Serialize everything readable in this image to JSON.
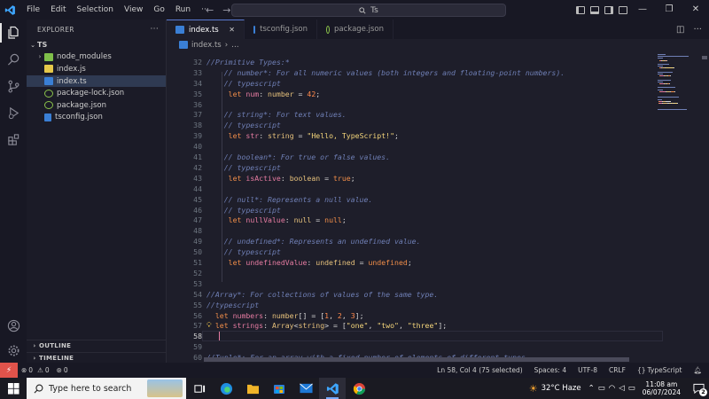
{
  "menu": [
    "File",
    "Edit",
    "Selection",
    "View",
    "Go",
    "Run",
    "···"
  ],
  "command_center": {
    "text": "Ts"
  },
  "window_controls": {
    "minimize": "—",
    "restore": "❐",
    "close": "✕"
  },
  "explorer": {
    "title": "EXPLORER",
    "more": "···",
    "root": "TS",
    "items": [
      {
        "label": "node_modules",
        "kind": "folder"
      },
      {
        "label": "index.js",
        "kind": "js"
      },
      {
        "label": "index.ts",
        "kind": "ts"
      },
      {
        "label": "package-lock.json",
        "kind": "json"
      },
      {
        "label": "package.json",
        "kind": "json"
      },
      {
        "label": "tsconfig.json",
        "kind": "tsconfig"
      }
    ],
    "outline": "OUTLINE",
    "timeline": "TIMELINE"
  },
  "tabs": [
    {
      "label": "index.ts",
      "close": "✕"
    },
    {
      "label": "tsconfig.json"
    },
    {
      "label": "package.json"
    }
  ],
  "breadcrumb": {
    "file": "index.ts",
    "more": "…"
  },
  "code_lines": [
    {
      "n": "32",
      "t": [
        [
          "//Primitive Types:*",
          "cm"
        ]
      ]
    },
    {
      "n": "33",
      "t": [
        [
          "    // number*: For all numeric values (both integers and floating-point numbers).",
          "cm"
        ]
      ]
    },
    {
      "n": "34",
      "t": [
        [
          "    // typescript",
          "cm"
        ]
      ]
    },
    {
      "n": "35",
      "t": [
        [
          "     ",
          "op"
        ],
        [
          "let",
          "kw"
        ],
        [
          " ",
          "op"
        ],
        [
          "num",
          "var"
        ],
        [
          ": ",
          "op"
        ],
        [
          "number",
          "ty"
        ],
        [
          " = ",
          "op"
        ],
        [
          "42",
          "num"
        ],
        [
          ";",
          "op"
        ]
      ]
    },
    {
      "n": "36",
      "t": []
    },
    {
      "n": "37",
      "t": [
        [
          "    // string*: For text values.",
          "cm"
        ]
      ]
    },
    {
      "n": "38",
      "t": [
        [
          "    // typescript",
          "cm"
        ]
      ]
    },
    {
      "n": "39",
      "t": [
        [
          "     ",
          "op"
        ],
        [
          "let",
          "kw"
        ],
        [
          " ",
          "op"
        ],
        [
          "str",
          "var"
        ],
        [
          ": ",
          "op"
        ],
        [
          "string",
          "ty"
        ],
        [
          " = ",
          "op"
        ],
        [
          "\"Hello, TypeScript!\"",
          "str"
        ],
        [
          ";",
          "op"
        ]
      ]
    },
    {
      "n": "40",
      "t": []
    },
    {
      "n": "41",
      "t": [
        [
          "    // boolean*: For true or false values.",
          "cm"
        ]
      ]
    },
    {
      "n": "42",
      "t": [
        [
          "    // typescript",
          "cm"
        ]
      ]
    },
    {
      "n": "43",
      "t": [
        [
          "     ",
          "op"
        ],
        [
          "let",
          "kw"
        ],
        [
          " ",
          "op"
        ],
        [
          "isActive",
          "var"
        ],
        [
          ": ",
          "op"
        ],
        [
          "boolean",
          "ty"
        ],
        [
          " = ",
          "op"
        ],
        [
          "true",
          "kw"
        ],
        [
          ";",
          "op"
        ]
      ]
    },
    {
      "n": "44",
      "t": []
    },
    {
      "n": "45",
      "t": [
        [
          "    // null*: Represents a null value.",
          "cm"
        ]
      ]
    },
    {
      "n": "46",
      "t": [
        [
          "    // typescript",
          "cm"
        ]
      ]
    },
    {
      "n": "47",
      "t": [
        [
          "     ",
          "op"
        ],
        [
          "let",
          "kw"
        ],
        [
          " ",
          "op"
        ],
        [
          "nullValue",
          "var"
        ],
        [
          ": ",
          "op"
        ],
        [
          "null",
          "ty"
        ],
        [
          " = ",
          "op"
        ],
        [
          "null",
          "kw"
        ],
        [
          ";",
          "op"
        ]
      ]
    },
    {
      "n": "48",
      "t": []
    },
    {
      "n": "49",
      "t": [
        [
          "    // undefined*: Represents an undefined value.",
          "cm"
        ]
      ]
    },
    {
      "n": "50",
      "t": [
        [
          "    // typescript",
          "cm"
        ]
      ]
    },
    {
      "n": "51",
      "t": [
        [
          "     ",
          "op"
        ],
        [
          "let",
          "kw"
        ],
        [
          " ",
          "op"
        ],
        [
          "undefinedValue",
          "var"
        ],
        [
          ": ",
          "op"
        ],
        [
          "undefined",
          "ty"
        ],
        [
          " = ",
          "op"
        ],
        [
          "undefined",
          "kw"
        ],
        [
          ";",
          "op"
        ]
      ]
    },
    {
      "n": "52",
      "t": []
    },
    {
      "n": "53",
      "t": []
    },
    {
      "n": "54",
      "t": [
        [
          "//Array*: For collections of values of the same type.",
          "cm"
        ]
      ]
    },
    {
      "n": "55",
      "t": [
        [
          "//typescript",
          "cm"
        ]
      ]
    },
    {
      "n": "56",
      "t": [
        [
          "  ",
          "op"
        ],
        [
          "let",
          "kw"
        ],
        [
          " ",
          "op"
        ],
        [
          "numbers",
          "var"
        ],
        [
          ": ",
          "op"
        ],
        [
          "number",
          "ty"
        ],
        [
          "[] = [",
          "op"
        ],
        [
          "1",
          "num"
        ],
        [
          ", ",
          "op"
        ],
        [
          "2",
          "num"
        ],
        [
          ", ",
          "op"
        ],
        [
          "3",
          "num"
        ],
        [
          "];",
          "op"
        ]
      ]
    },
    {
      "n": "57",
      "t": [
        [
          "  ",
          "op"
        ],
        [
          "let",
          "kw"
        ],
        [
          " ",
          "op"
        ],
        [
          "strings",
          "var"
        ],
        [
          ": ",
          "op"
        ],
        [
          "Array",
          "ty"
        ],
        [
          "<",
          "op"
        ],
        [
          "string",
          "ty"
        ],
        [
          "> = [",
          "op"
        ],
        [
          "\"one\"",
          "str"
        ],
        [
          ", ",
          "op"
        ],
        [
          "\"two\"",
          "str"
        ],
        [
          ", ",
          "op"
        ],
        [
          "\"three\"",
          "str"
        ],
        [
          "];",
          "op"
        ]
      ]
    },
    {
      "n": "58",
      "t": []
    },
    {
      "n": "59",
      "t": []
    },
    {
      "n": "60",
      "t": [
        [
          "//Tuple*: For an array with a fixed number of elements of different types.",
          "cm"
        ]
      ]
    }
  ],
  "current_line": "58",
  "syntax_colors": {
    "cm": "#6f7fb5",
    "kw": "#f08d49",
    "var": "#e57ba1",
    "ty": "#e5c07b",
    "num": "#ff8a4c",
    "str": "#f5d67b",
    "op": "#d4d4d4"
  },
  "status": {
    "errors": "0",
    "warnings": "0",
    "ports": "0",
    "position": "Ln 58, Col 4 (75 selected)",
    "spaces": "Spaces: 4",
    "encoding": "UTF-8",
    "eol": "CRLF",
    "language": "TypeScript",
    "language_glyph": "{}"
  },
  "taskbar": {
    "search_placeholder": "Type here to search",
    "weather": "32°C  Haze",
    "time": "11:08 am",
    "date": "06/07/2024",
    "notifications": "2"
  },
  "icons": {
    "explorer": "files-icon",
    "search": "search-icon",
    "scm": "source-control-icon",
    "debug": "run-debug-icon",
    "extensions": "extensions-icon",
    "account": "account-icon",
    "settings": "gear-icon"
  }
}
